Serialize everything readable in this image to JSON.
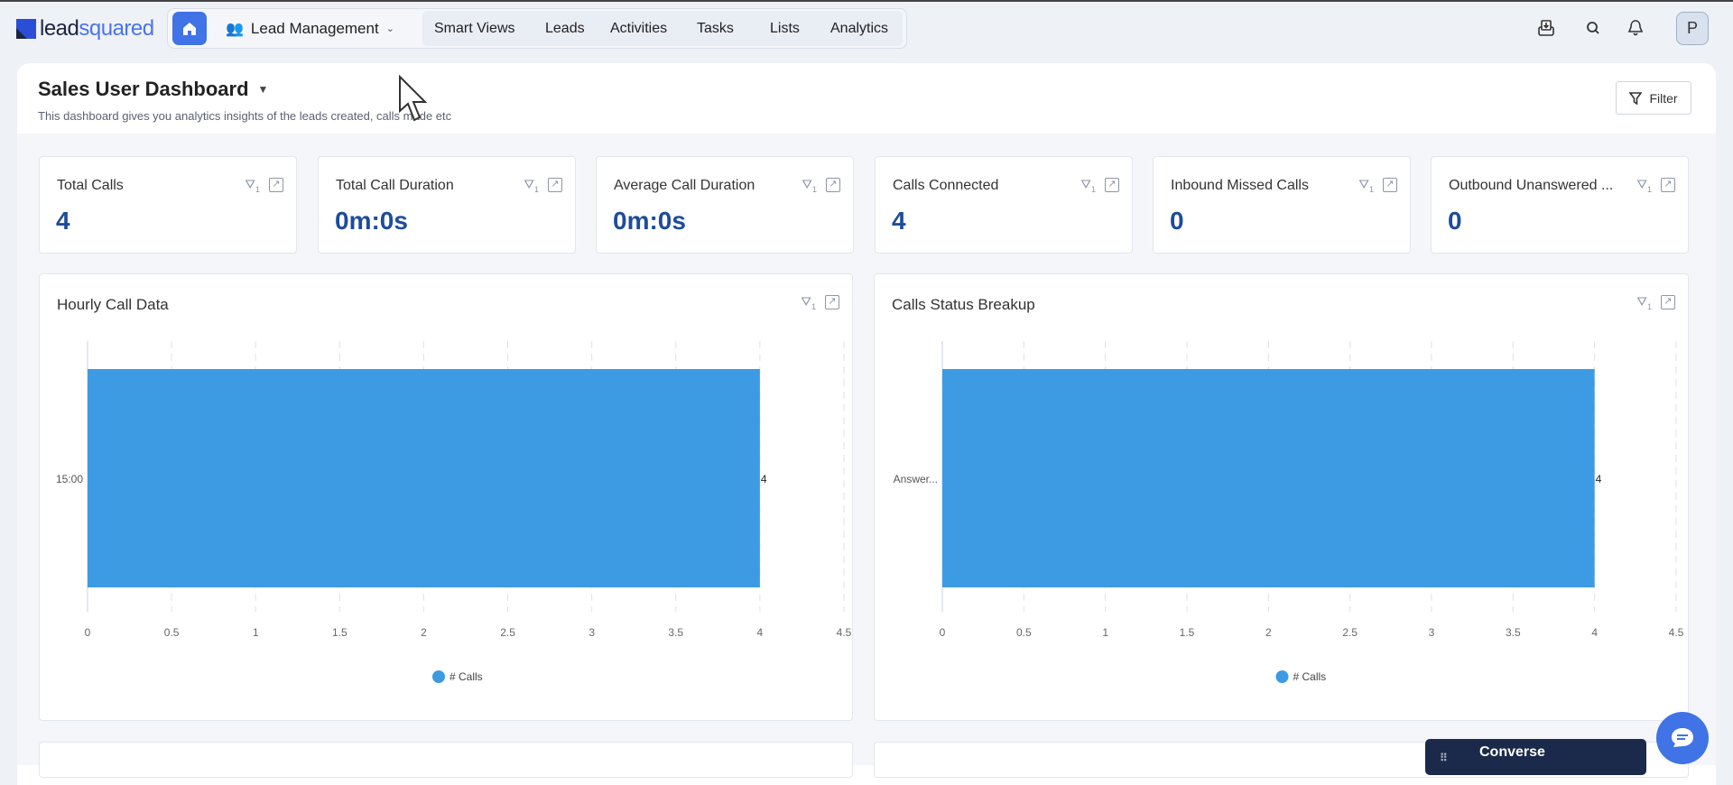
{
  "brand": {
    "logo_text_1": "lead",
    "logo_text_2": "squared"
  },
  "nav": {
    "module": "Lead Management",
    "links": [
      "Smart Views",
      "Leads",
      "Activities",
      "Tasks",
      "Lists",
      "Analytics"
    ],
    "avatar_initial": "P"
  },
  "header": {
    "title": "Sales User Dashboard",
    "subtitle": "This dashboard gives you analytics insights of the leads created, calls made etc",
    "filter_label": "Filter"
  },
  "stats": [
    {
      "label": "Total Calls",
      "value": "4"
    },
    {
      "label": "Total Call Duration",
      "value": "0m:0s"
    },
    {
      "label": "Average Call Duration",
      "value": "0m:0s"
    },
    {
      "label": "Calls Connected",
      "value": "4"
    },
    {
      "label": "Inbound Missed Calls",
      "value": "0"
    },
    {
      "label": "Outbound Unanswered ...",
      "value": "0"
    }
  ],
  "chart_data": [
    {
      "type": "bar",
      "orientation": "horizontal",
      "title": "Hourly Call Data",
      "categories": [
        "15:00"
      ],
      "series": [
        {
          "name": "# Calls",
          "values": [
            4
          ]
        }
      ],
      "xlim": [
        0,
        4.5
      ],
      "xticks": [
        "0",
        "0.5",
        "1",
        "1.5",
        "2",
        "2.5",
        "3",
        "3.5",
        "4",
        "4.5"
      ],
      "data_labels": [
        "4"
      ],
      "grid": true,
      "legend": "bottom",
      "color": "#3d9be3"
    },
    {
      "type": "bar",
      "orientation": "horizontal",
      "title": "Calls Status Breakup",
      "categories": [
        "Answer..."
      ],
      "series": [
        {
          "name": "# Calls",
          "values": [
            4
          ]
        }
      ],
      "xlim": [
        0,
        4.5
      ],
      "xticks": [
        "0",
        "0.5",
        "1",
        "1.5",
        "2",
        "2.5",
        "3",
        "3.5",
        "4",
        "4.5"
      ],
      "data_labels": [
        "4"
      ],
      "grid": true,
      "legend": "bottom",
      "color": "#3d9be3"
    }
  ],
  "converse": {
    "label": "Converse"
  },
  "colors": {
    "accent": "#3f73e6",
    "value": "#1d4c9a",
    "bar": "#3d9be3",
    "converse_bg": "#1b2a4a"
  }
}
